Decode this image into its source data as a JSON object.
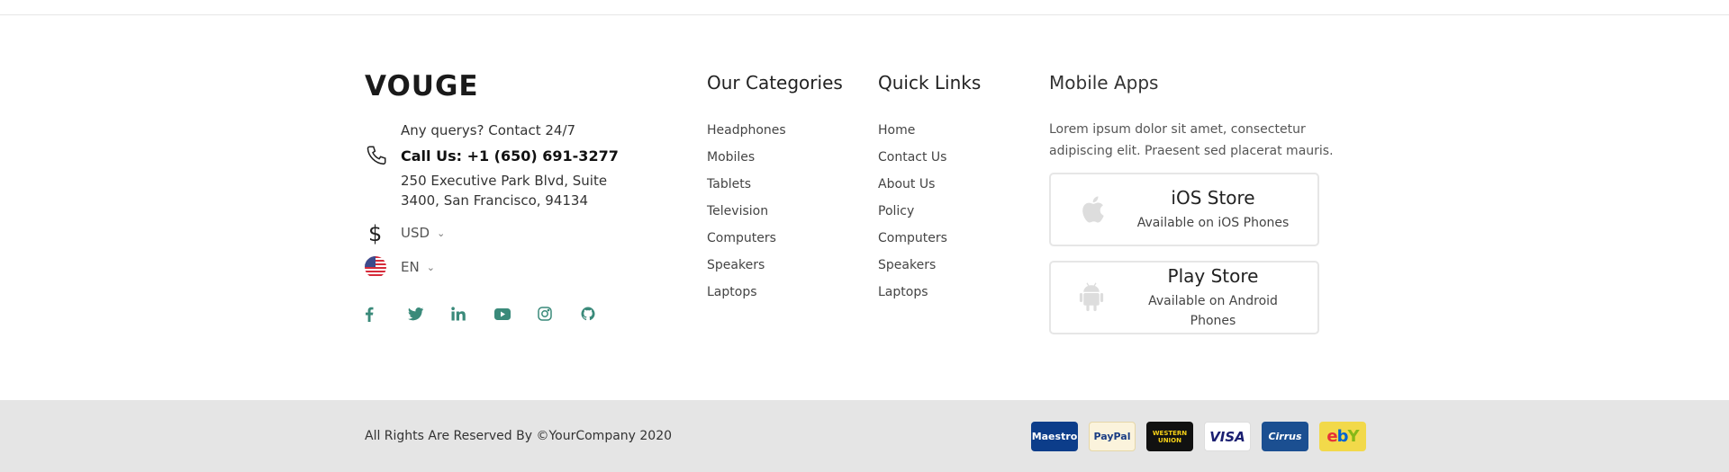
{
  "brand": {
    "logo_text": "VOUGE",
    "contact_prompt": "Any querys? Contact 24/7",
    "phone": "Call Us: +1 (650) 691-3277",
    "address": "250 Executive Park Blvd, Suite 3400, San Francisco, 94134",
    "currency": "USD",
    "language": "EN"
  },
  "social_icons": [
    "facebook-icon",
    "twitter-icon",
    "linkedin-icon",
    "youtube-icon",
    "instagram-icon",
    "github-icon"
  ],
  "categories": {
    "title": "Our Categories",
    "items": [
      "Headphones",
      "Mobiles",
      "Tablets",
      "Television",
      "Computers",
      "Speakers",
      "Laptops"
    ]
  },
  "quick_links": {
    "title": "Quick Links",
    "items": [
      "Home",
      "Contact Us",
      "About Us",
      "Policy",
      "Computers",
      "Speakers",
      "Laptops"
    ]
  },
  "mobile_apps": {
    "title": "Mobile Apps",
    "description": "Lorem ipsum dolor sit amet, consectetur adipiscing elit. Praesent sed placerat mauris.",
    "ios": {
      "name": "iOS Store",
      "sub": "Available on iOS Phones"
    },
    "android": {
      "name": "Play Store",
      "sub": "Available on Android Phones"
    }
  },
  "footer": {
    "copyright": "All Rights Are Reserved By ©YourCompany 2020",
    "payment_labels": {
      "maestro": "Maestro",
      "paypal": "PayPal",
      "western_union": "WESTERN UNION",
      "visa": "VISA",
      "cirrus": "Cirrus",
      "ebay": "ebY"
    }
  },
  "colors": {
    "accent": "#3a8a7a",
    "bottom_bar": "#e5e5e5",
    "app_icon": "#dddddd"
  }
}
